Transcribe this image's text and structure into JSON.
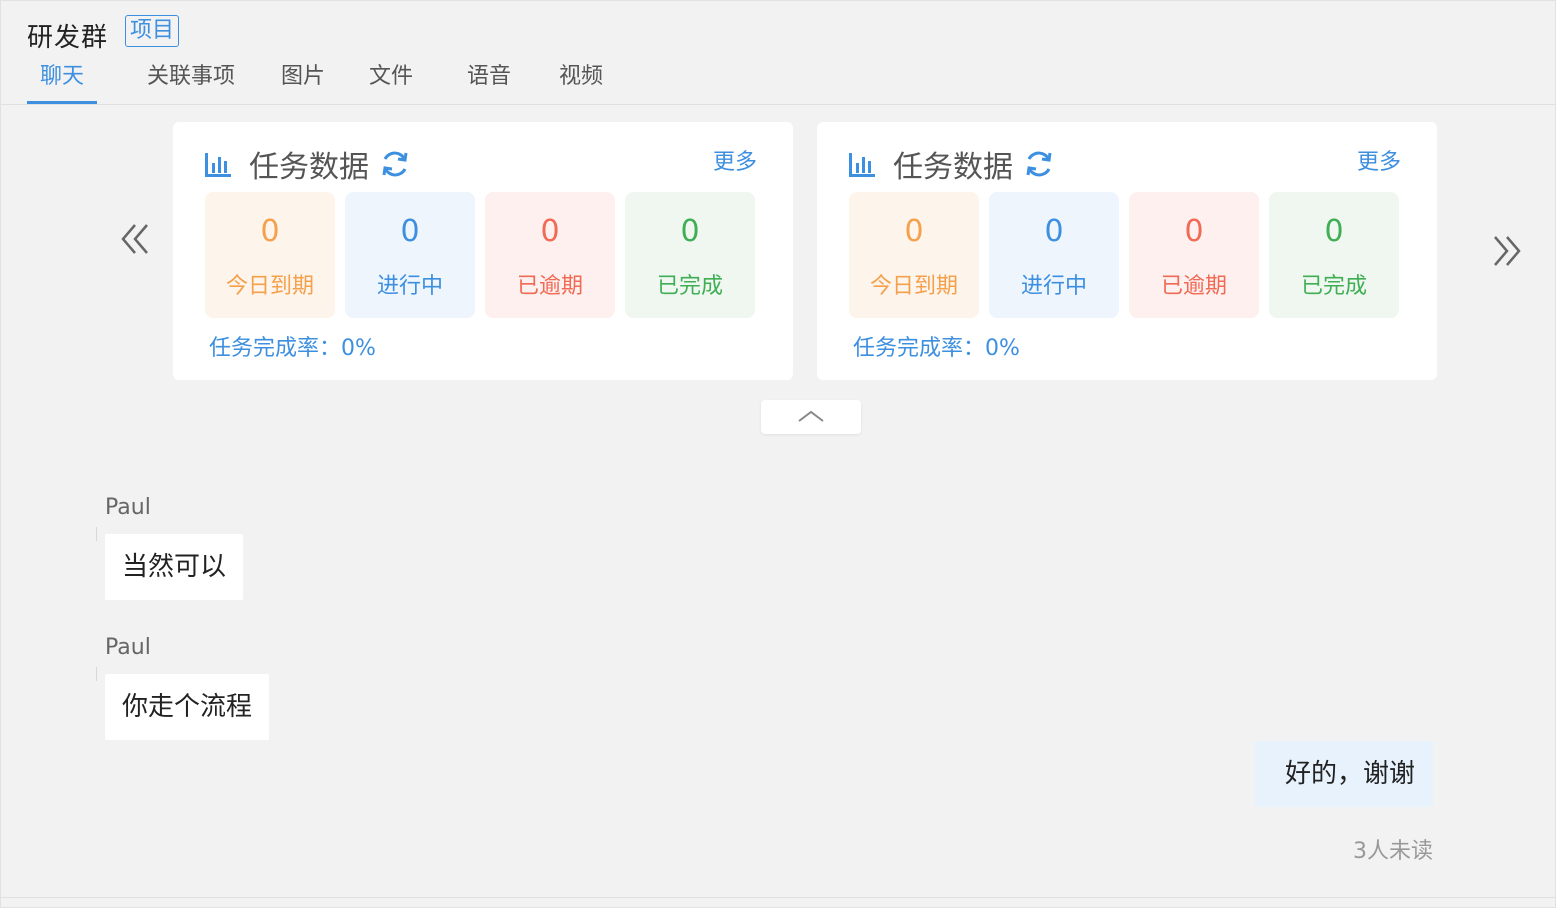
{
  "header": {
    "group_name": "研发群",
    "group_tag": "项目"
  },
  "tabs": [
    {
      "label": "聊天",
      "active": true
    },
    {
      "label": "关联事项",
      "active": false
    },
    {
      "label": "图片",
      "active": false
    },
    {
      "label": "文件",
      "active": false
    },
    {
      "label": "语音",
      "active": false
    },
    {
      "label": "视频",
      "active": false
    }
  ],
  "carousel": {
    "prev_icon": "double-chevron-left-icon",
    "next_icon": "double-chevron-right-icon",
    "collapse_icon": "chevron-up-icon",
    "cards": [
      {
        "title": "任务数据",
        "icon": "bar-chart-icon",
        "refresh_icon": "refresh-icon",
        "more": "更多",
        "stats": [
          {
            "value": "0",
            "label": "今日到期",
            "color": "#f5a04a"
          },
          {
            "value": "0",
            "label": "进行中",
            "color": "#3d8fe0"
          },
          {
            "value": "0",
            "label": "已逾期",
            "color": "#f06a55"
          },
          {
            "value": "0",
            "label": "已完成",
            "color": "#3fae54"
          }
        ],
        "rate_label": "任务完成率：0%"
      },
      {
        "title": "任务数据",
        "icon": "bar-chart-icon",
        "refresh_icon": "refresh-icon",
        "more": "更多",
        "stats": [
          {
            "value": "0",
            "label": "今日到期",
            "color": "#f5a04a"
          },
          {
            "value": "0",
            "label": "进行中",
            "color": "#3d8fe0"
          },
          {
            "value": "0",
            "label": "已逾期",
            "color": "#f06a55"
          },
          {
            "value": "0",
            "label": "已完成",
            "color": "#3fae54"
          }
        ],
        "rate_label": "任务完成率：0%"
      }
    ]
  },
  "messages": [
    {
      "sender": "Paul",
      "text": "当然可以",
      "self": false
    },
    {
      "sender": "Paul",
      "text": "你走个流程",
      "self": false
    },
    {
      "sender": "",
      "text": "好的，谢谢",
      "self": true,
      "status": "3人未读"
    }
  ],
  "colors": {
    "accent": "#3d8fe0",
    "background": "#f2f2f2",
    "self_bubble": "#e8f2fc"
  }
}
